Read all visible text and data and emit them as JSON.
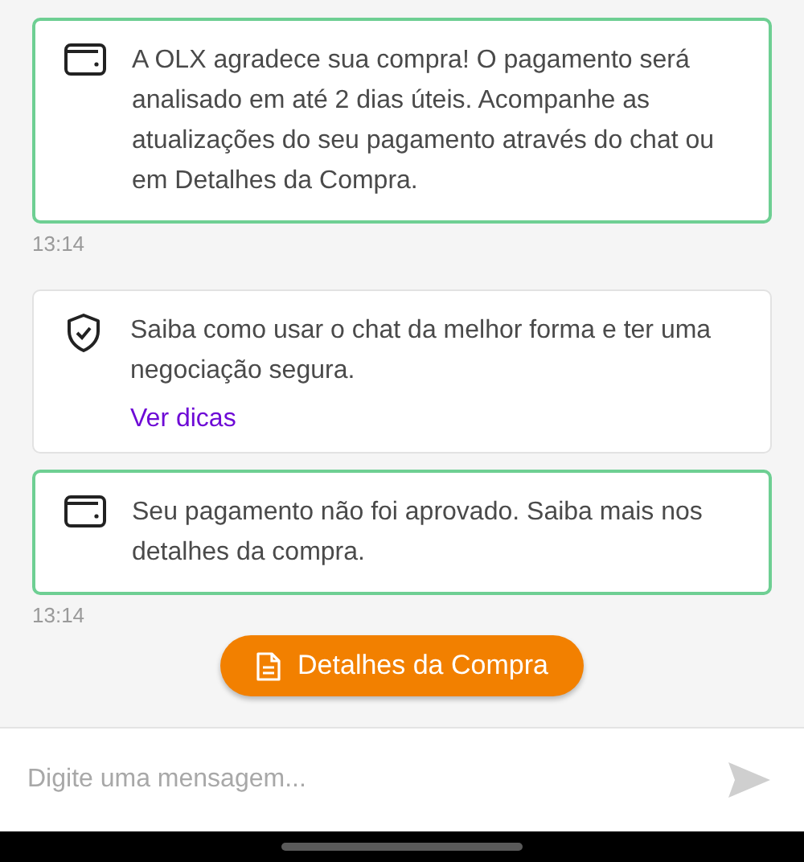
{
  "messages": [
    {
      "kind": "payment",
      "text": "A OLX agradece sua compra! O pagamento será analisado em até 2 dias úteis. Acompanhe as atualizações do seu pagamento através do chat ou em Detalhes da Compra.",
      "time": "13:14"
    },
    {
      "kind": "tip",
      "text": "Saiba como usar o chat da melhor forma e ter uma negociação segura.",
      "link": "Ver dicas"
    },
    {
      "kind": "payment",
      "text": "Seu pagamento não foi aprovado. Saiba mais nos detalhes da compra.",
      "time": "13:14"
    }
  ],
  "action_button": {
    "label": "Detalhes da Compra"
  },
  "composer": {
    "placeholder": "Digite uma mensagem..."
  }
}
